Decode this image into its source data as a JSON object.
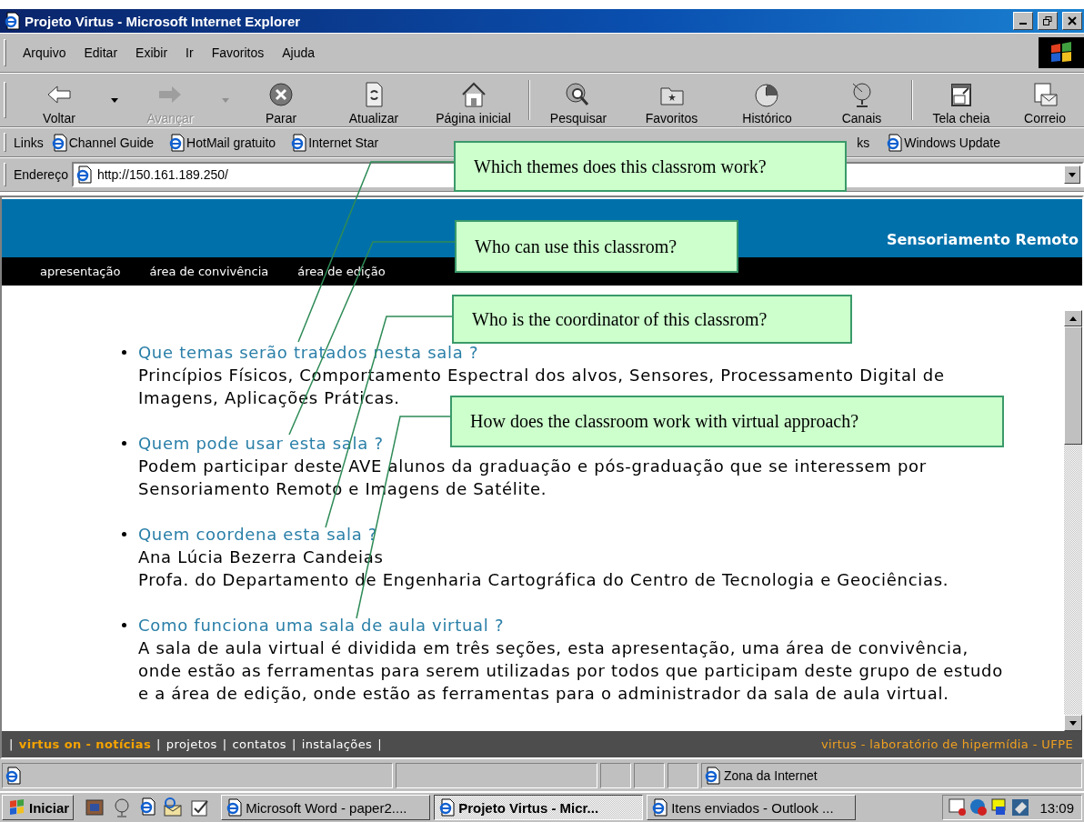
{
  "window": {
    "title": "Projeto Virtus - Microsoft Internet Explorer"
  },
  "menu": [
    "Arquivo",
    "Editar",
    "Exibir",
    "Ir",
    "Favoritos",
    "Ajuda"
  ],
  "toolbar": [
    {
      "label": "Voltar",
      "disabled": false,
      "dropdown": true
    },
    {
      "label": "Avançar",
      "disabled": true,
      "dropdown": true
    },
    {
      "label": "Parar",
      "disabled": false,
      "dropdown": false
    },
    {
      "label": "Atualizar",
      "disabled": false,
      "dropdown": false
    },
    {
      "label": "Página inicial",
      "disabled": false,
      "dropdown": false
    },
    {
      "label": "Pesquisar",
      "disabled": false,
      "dropdown": false
    },
    {
      "label": "Favoritos",
      "disabled": false,
      "dropdown": false
    },
    {
      "label": "Histórico",
      "disabled": false,
      "dropdown": false
    },
    {
      "label": "Canais",
      "disabled": false,
      "dropdown": false
    },
    {
      "label": "Tela cheia",
      "disabled": false,
      "dropdown": false
    },
    {
      "label": "Correio",
      "disabled": false,
      "dropdown": false
    }
  ],
  "links": {
    "label": "Links",
    "items": [
      {
        "label": "Channel Guide",
        "icon": true
      },
      {
        "label": "HotMail gratuito",
        "icon": true
      },
      {
        "label": "Internet Star",
        "icon": true
      },
      {
        "label": "ks",
        "icon": false
      },
      {
        "label": "Windows Update",
        "icon": true
      }
    ]
  },
  "address": {
    "label": "Endereço",
    "value": "http://150.161.189.250/"
  },
  "page": {
    "header_title": "Sensoriamento Remoto",
    "nav": [
      "apresentação",
      "área de convivência",
      "área de edição"
    ],
    "faq": [
      {
        "question": "Que temas serão tratados nesta sala ?",
        "answer": [
          "Princípios Físicos, Comportamento Espectral dos alvos, Sensores, Processamento Digital de Imagens, Aplicações Práticas."
        ]
      },
      {
        "question": "Quem pode usar esta sala ?",
        "answer": [
          "Podem participar deste AVE alunos da graduação e pós-graduação que se interessem por Sensoriamento Remoto e Imagens de Satélite."
        ]
      },
      {
        "question": "Quem coordena esta sala ?",
        "answer": [
          "Ana Lúcia Bezerra Candeias",
          "Profa. do Departamento de Engenharia Cartográfica do Centro de Tecnologia e Geociências."
        ]
      },
      {
        "question": "Como funciona uma sala de aula virtual ?",
        "answer": [
          "A sala de aula virtual é dividida em três seções, esta apresentação, uma área de convivência, onde estão as ferramentas para serem utilizadas por todos que participam deste grupo de estudo e a área de edição, onde estão as ferramentas para o administrador da sala de aula virtual."
        ]
      }
    ],
    "footer": {
      "separator": "|",
      "links": [
        {
          "label": "virtus on - notícias",
          "selected": true
        },
        {
          "label": "projetos",
          "selected": false
        },
        {
          "label": "contatos",
          "selected": false
        },
        {
          "label": "instalações",
          "selected": false
        }
      ],
      "credit": "virtus - laboratório de hipermídia - UFPE"
    }
  },
  "status_bar": {
    "zone": "Zona da Internet"
  },
  "taskbar": {
    "start": "Iniciar",
    "tasks": [
      {
        "label": "Microsoft Word - paper2....",
        "selected": false
      },
      {
        "label": "Projeto Virtus - Micr...",
        "selected": true
      },
      {
        "label": "Itens enviados - Outlook ...",
        "selected": false
      }
    ],
    "clock": "13:09"
  },
  "callouts": [
    {
      "text": "Which themes does this classrom work?"
    },
    {
      "text": "Who can use this classrom?"
    },
    {
      "text": "Who is the coordinator of this classrom?"
    },
    {
      "text": "How does the classroom work with virtual approach?"
    }
  ]
}
